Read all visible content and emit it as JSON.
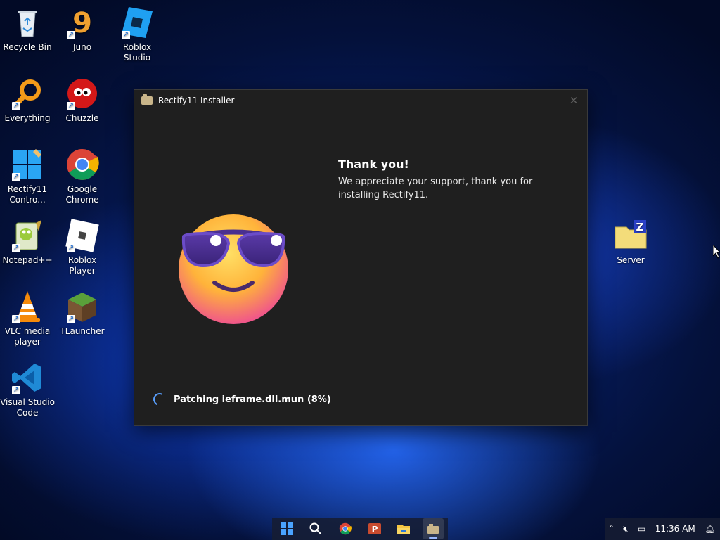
{
  "desktop_icons": [
    {
      "label": "Recycle Bin"
    },
    {
      "label": "Juno"
    },
    {
      "label": "Roblox Studio"
    },
    {
      "label": "Everything"
    },
    {
      "label": "Chuzzle"
    },
    {
      "label": "Rectify11 Contro..."
    },
    {
      "label": "Google Chrome"
    },
    {
      "label": "Notepad++"
    },
    {
      "label": "Roblox Player"
    },
    {
      "label": "VLC media player"
    },
    {
      "label": "TLauncher"
    },
    {
      "label": "Visual Studio Code"
    },
    {
      "label": "Server"
    }
  ],
  "window": {
    "title": "Rectify11 Installer",
    "close_icon": "✕",
    "heading": "Thank you!",
    "message": "We appreciate your support, thank you for installing Rectify11.",
    "status": "Patching ieframe.dll.mun (8%)",
    "progress_percent": 8
  },
  "taskbar": {
    "apps": [
      "start-icon",
      "search-icon",
      "chrome-icon",
      "powerpoint-icon",
      "file-explorer-icon",
      "installer-icon"
    ],
    "powerpoint_letter": "P",
    "time": "11:36 AM"
  },
  "colors": {
    "window_bg": "#1f1f1f",
    "accent": "#5aa0ff"
  }
}
